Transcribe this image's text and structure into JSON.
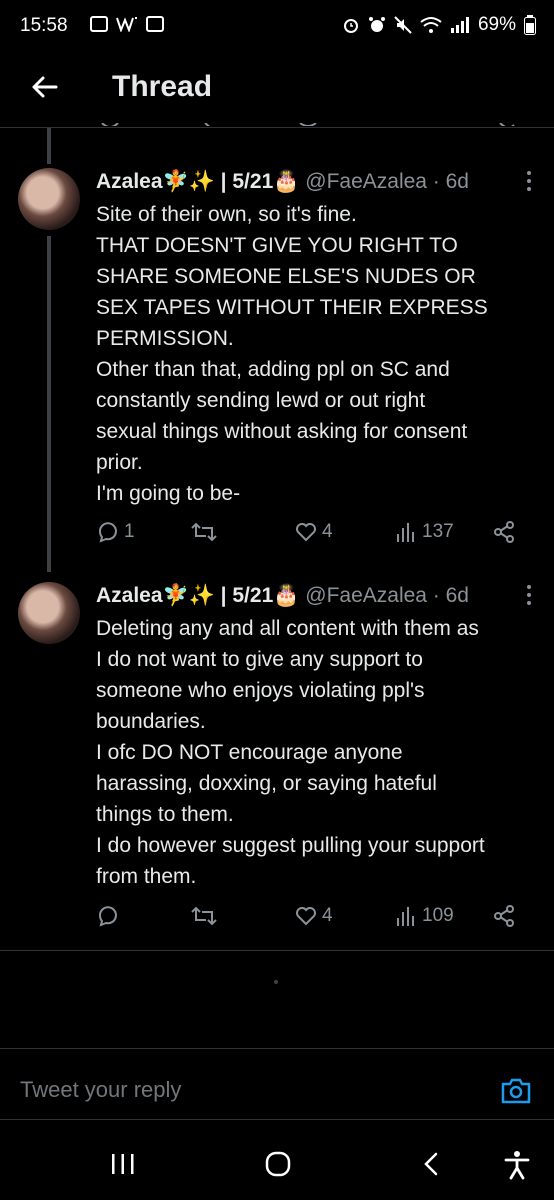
{
  "status_bar": {
    "time": "15:58",
    "battery": "69%"
  },
  "header": {
    "title": "Thread"
  },
  "tweets": [
    {
      "name": "Azalea🧚✨ | 5/21🎂",
      "handle": "@FaeAzalea · 6d",
      "lines": [
        "Site of their own, so it's fine.",
        "THAT DOESN'T GIVE YOU RIGHT TO",
        "SHARE SOMEONE ELSE'S NUDES OR",
        "SEX TAPES WITHOUT THEIR EXPRESS",
        "PERMISSION.",
        "Other than that, adding ppl on SC and",
        "constantly sending lewd or out right",
        "sexual things without asking for consent",
        "prior.",
        "I'm going to be-"
      ],
      "replies": "1",
      "retweets": "",
      "likes": "4",
      "views": "137"
    },
    {
      "name": "Azalea🧚✨ | 5/21🎂",
      "handle": "@FaeAzalea · 6d",
      "lines": [
        "Deleting any and all content with them as",
        "I do not want to give any support to",
        "someone who enjoys violating ppl's",
        "boundaries.",
        "I ofc DO NOT encourage anyone",
        "harassing, doxxing, or saying hateful",
        "things to them.",
        "I do however suggest pulling your support",
        "from them."
      ],
      "replies": "",
      "retweets": "",
      "likes": "4",
      "views": "109"
    }
  ],
  "reply": {
    "placeholder": "Tweet your reply"
  },
  "colors": {
    "background": "#000000",
    "text": "#e7e9ea",
    "secondary": "#8b9298",
    "accent": "#1d9bf0"
  },
  "icons": [
    "back-arrow-icon",
    "more-icon",
    "reply-icon",
    "retweet-icon",
    "like-icon",
    "views-icon",
    "share-icon",
    "camera-icon",
    "recents-icon",
    "home-icon",
    "back-icon",
    "accessibility-icon"
  ]
}
